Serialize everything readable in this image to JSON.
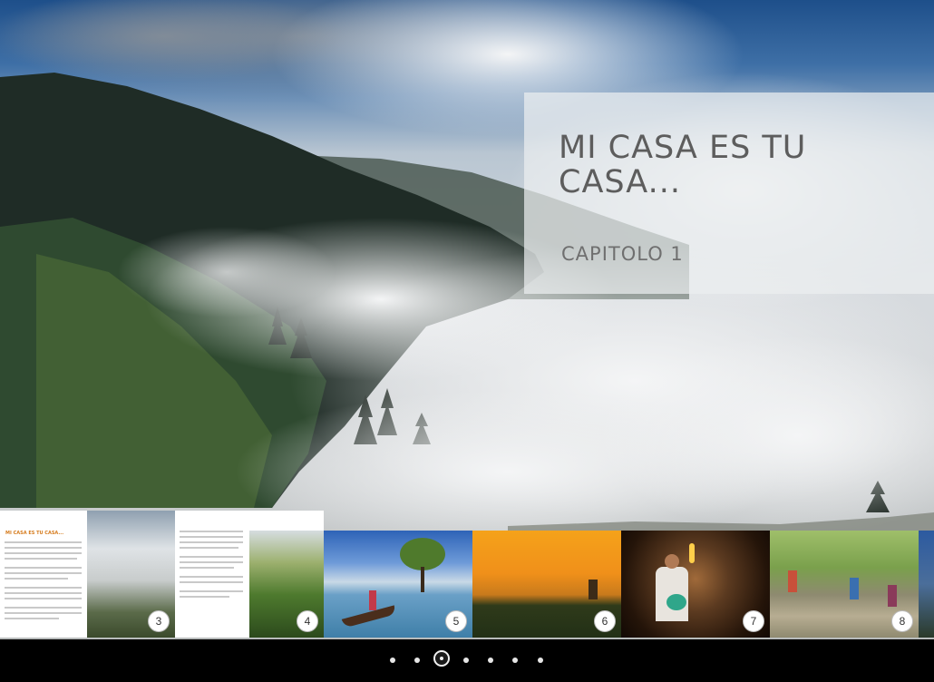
{
  "chapter": {
    "title": "MI CASA ES TU CASA...",
    "subtitle": "CAPITOLO 1"
  },
  "thumbnails": [
    {
      "page": "3",
      "kind": "text+fog-mountain",
      "heading": "MI CASA ES TU CASA..."
    },
    {
      "page": "4",
      "kind": "text+jungle"
    },
    {
      "page": "5",
      "kind": "lake-canoe-tree"
    },
    {
      "page": "6",
      "kind": "orange-sunset-temple"
    },
    {
      "page": "7",
      "kind": "cave-torch-man"
    },
    {
      "page": "8",
      "kind": "hill-path-walkers"
    }
  ],
  "pagination": {
    "count": 7,
    "active_index": 2
  },
  "colors": {
    "title_text": "#5d5d5d",
    "panel_bg": "rgba(236,238,240,0.72)",
    "bottom_bar": "#000000"
  }
}
